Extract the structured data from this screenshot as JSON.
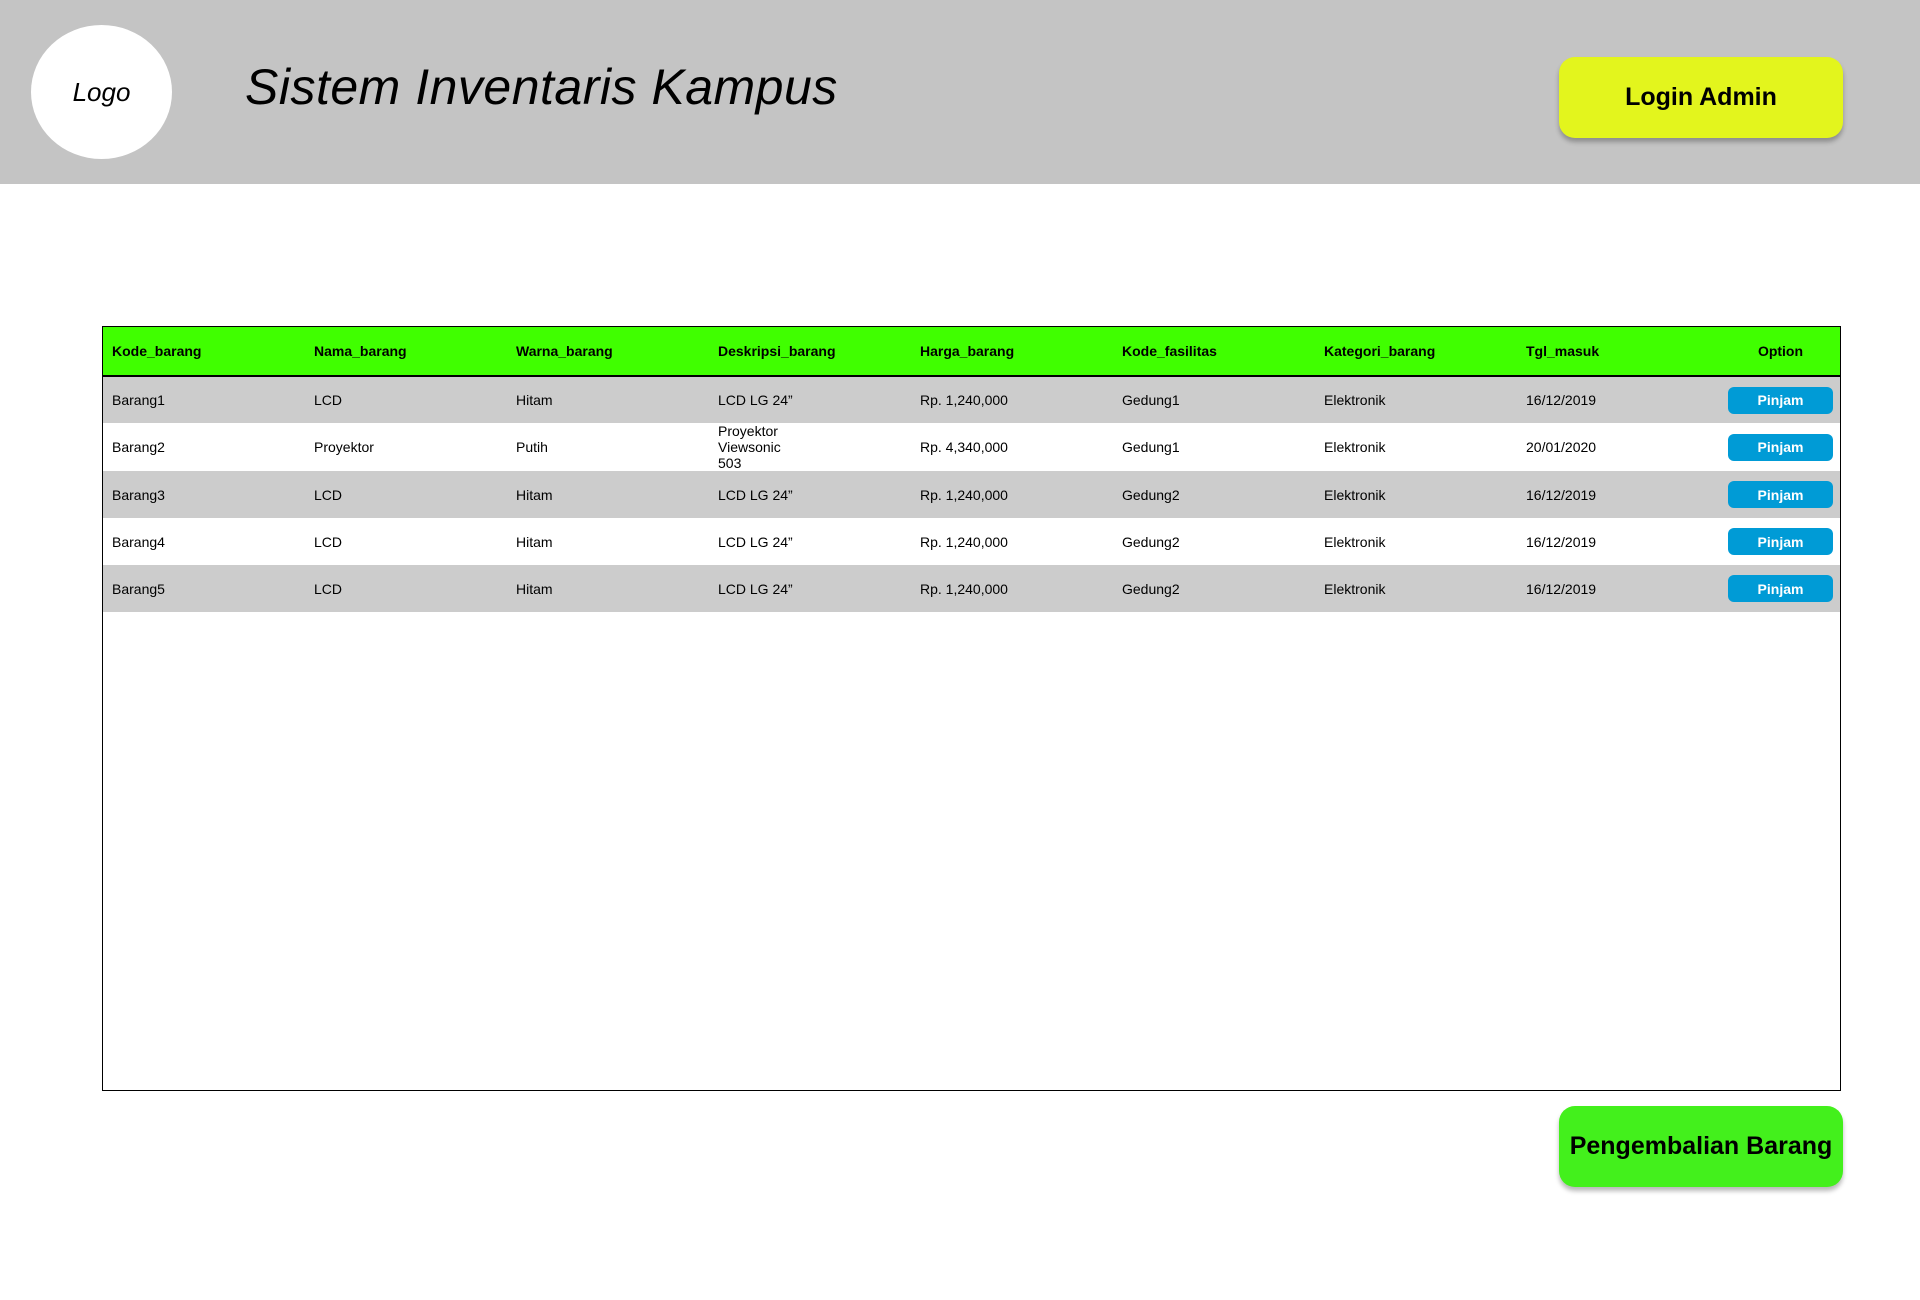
{
  "header": {
    "logo_text": "Logo",
    "title": "Sistem Inventaris Kampus",
    "login_label": "Login Admin",
    "background": "#c4c4c4",
    "login_color": "#e3f51d"
  },
  "table": {
    "header_color": "#40ff00",
    "columns": [
      "Kode_barang",
      "Nama_barang",
      "Warna_barang",
      "Deskripsi_barang",
      "Harga_barang",
      "Kode_fasilitas",
      "Kategori_barang",
      "Tgl_masuk",
      "Option"
    ],
    "rows": [
      {
        "kode": "Barang1",
        "nama": "LCD",
        "warna": "Hitam",
        "deskripsi": "LCD LG 24”",
        "harga": "Rp. 1,240,000",
        "fasilitas": "Gedung1",
        "kategori": "Elektronik",
        "tgl": "16/12/2019",
        "option": "Pinjam"
      },
      {
        "kode": "Barang2",
        "nama": "Proyektor",
        "warna": "Putih",
        "deskripsi": "Proyektor\nViewsonic\n503",
        "harga": "Rp. 4,340,000",
        "fasilitas": "Gedung1",
        "kategori": "Elektronik",
        "tgl": "20/01/2020",
        "option": "Pinjam"
      },
      {
        "kode": "Barang3",
        "nama": "LCD",
        "warna": "Hitam",
        "deskripsi": "LCD LG 24”",
        "harga": "Rp. 1,240,000",
        "fasilitas": "Gedung2",
        "kategori": "Elektronik",
        "tgl": "16/12/2019",
        "option": "Pinjam"
      },
      {
        "kode": "Barang4",
        "nama": "LCD",
        "warna": "Hitam",
        "deskripsi": "LCD LG 24”",
        "harga": "Rp. 1,240,000",
        "fasilitas": "Gedung2",
        "kategori": "Elektronik",
        "tgl": "16/12/2019",
        "option": "Pinjam"
      },
      {
        "kode": "Barang5",
        "nama": "LCD",
        "warna": "Hitam",
        "deskripsi": "LCD LG 24”",
        "harga": "Rp. 1,240,000",
        "fasilitas": "Gedung2",
        "kategori": "Elektronik",
        "tgl": "16/12/2019",
        "option": "Pinjam"
      }
    ],
    "option_button_color": "#009bd6"
  },
  "footer": {
    "return_label": "Pengembalian Barang",
    "return_color": "#43f01c"
  }
}
